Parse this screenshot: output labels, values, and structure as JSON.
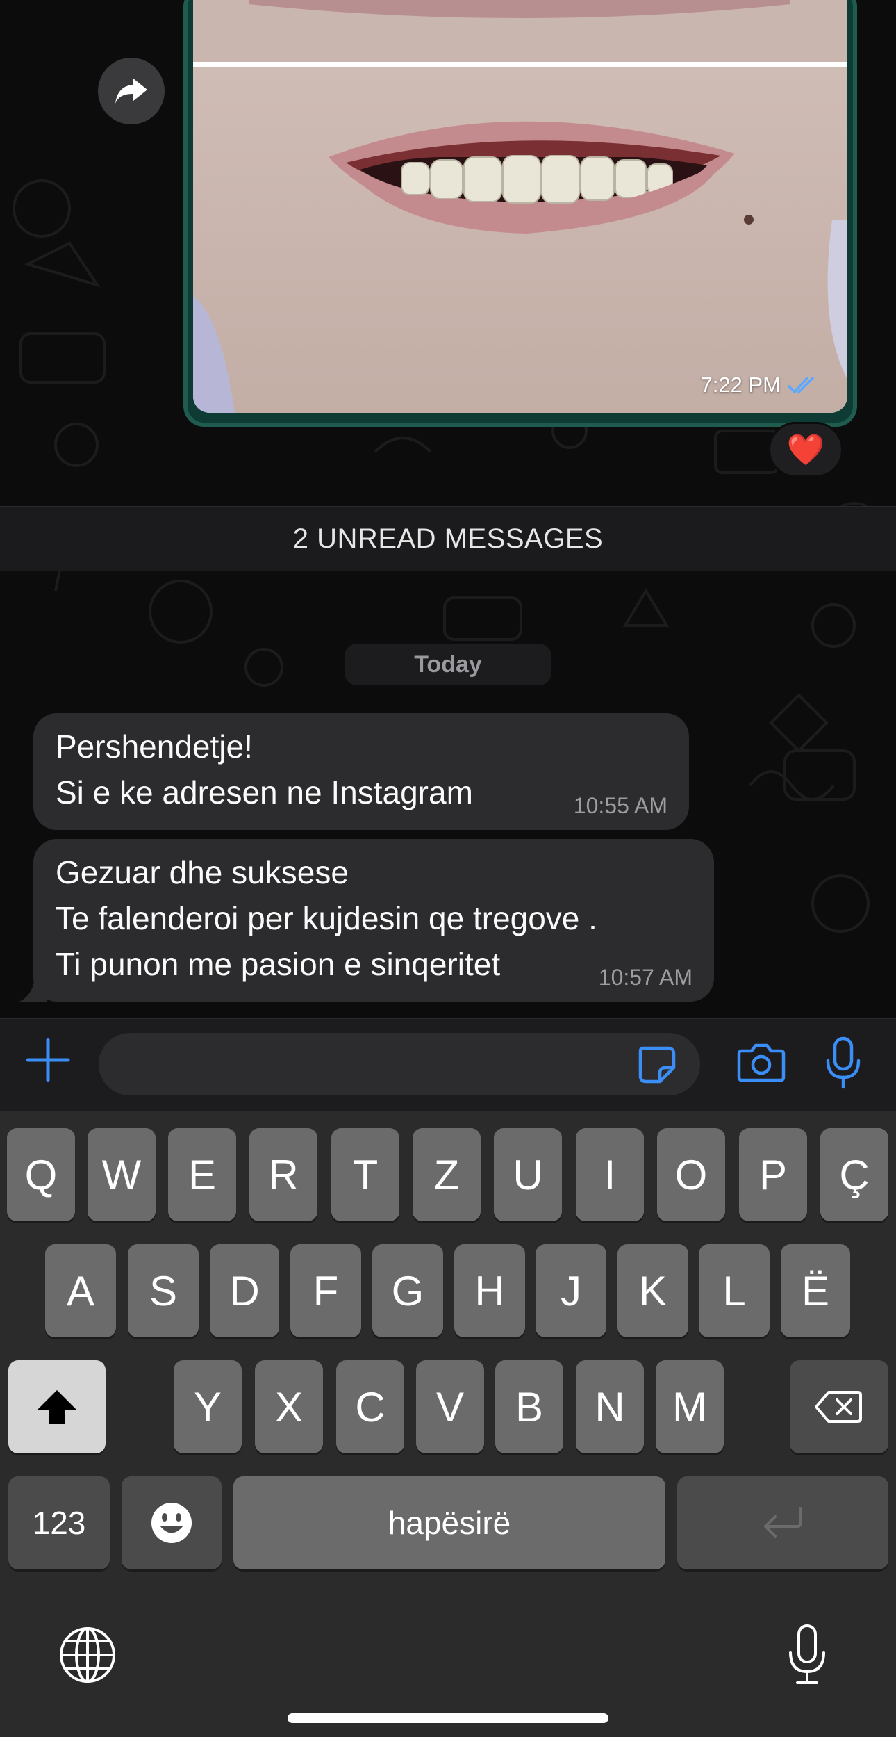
{
  "colors": {
    "accent_blue": "#3b8ef5",
    "bubble_incoming": "#2c2c2e",
    "bubble_outgoing": "#0e3b33",
    "keyboard_bg": "#2b2b2b",
    "key_bg": "#6b6b6b"
  },
  "outgoing_image_message": {
    "time": "7:22 PM",
    "status_icon": "double-check-icon",
    "reaction": "❤️",
    "forward_icon": "forward-arrow-icon"
  },
  "unread_banner": "2 UNREAD MESSAGES",
  "date_chip": "Today",
  "messages": [
    {
      "lines": [
        "Pershendetje!",
        "Si e ke adresen ne Instagram"
      ],
      "time": "10:55 AM"
    },
    {
      "lines": [
        "Gezuar dhe suksese",
        "Te falenderoi per kujdesin qe tregove .",
        "Ti punon me pasion e sinqeritet"
      ],
      "time": "10:57 AM"
    }
  ],
  "input_bar": {
    "plus_icon": "plus-icon",
    "sticker_icon": "sticker-icon",
    "camera_icon": "camera-icon",
    "mic_icon": "microphone-icon",
    "placeholder": ""
  },
  "keyboard": {
    "row1": [
      "Q",
      "W",
      "E",
      "R",
      "T",
      "Z",
      "U",
      "I",
      "O",
      "P",
      "Ç"
    ],
    "row2": [
      "A",
      "S",
      "D",
      "F",
      "G",
      "H",
      "J",
      "K",
      "L",
      "Ë"
    ],
    "row3": [
      "Y",
      "X",
      "C",
      "V",
      "B",
      "N",
      "M"
    ],
    "numbers_key": "123",
    "space_key": "hapësirë",
    "emoji_icon": "emoji-icon",
    "globe_icon": "globe-icon",
    "dictation_icon": "microphone-icon",
    "return_icon": "return-icon",
    "shift_icon": "shift-icon",
    "backspace_icon": "backspace-icon"
  }
}
